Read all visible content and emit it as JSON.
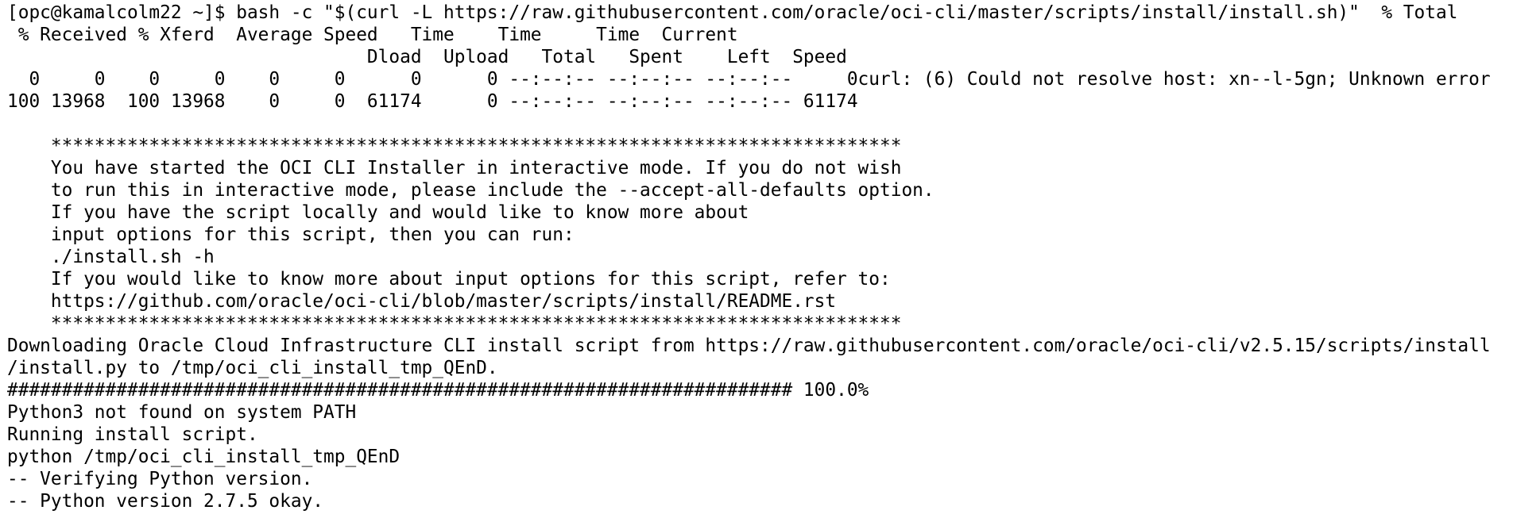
{
  "terminal": {
    "background": "#ffffff",
    "foreground": "#000000",
    "lines": [
      "[opc@kamalcolm22 ~]$ bash -c \"$(curl -L https://raw.githubusercontent.com/oracle/oci-cli/master/scripts/install/install.sh)\"  % Total",
      " % Received % Xferd  Average Speed   Time    Time     Time  Current",
      "                                 Dload  Upload   Total   Spent    Left  Speed",
      "  0     0    0     0    0     0      0      0 --:--:-- --:--:-- --:--:--     0curl: (6) Could not resolve host: xn--l-5gn; Unknown error",
      "100 13968  100 13968    0     0  61174      0 --:--:-- --:--:-- --:--:-- 61174",
      "",
      "    ******************************************************************************",
      "    You have started the OCI CLI Installer in interactive mode. If you do not wish",
      "    to run this in interactive mode, please include the --accept-all-defaults option.",
      "    If you have the script locally and would like to know more about",
      "    input options for this script, then you can run:",
      "    ./install.sh -h",
      "    If you would like to know more about input options for this script, refer to:",
      "    https://github.com/oracle/oci-cli/blob/master/scripts/install/README.rst",
      "    ******************************************************************************",
      "Downloading Oracle Cloud Infrastructure CLI install script from https://raw.githubusercontent.com/oracle/oci-cli/v2.5.15/scripts/install",
      "/install.py to /tmp/oci_cli_install_tmp_QEnD.",
      "######################################################################## 100.0%",
      "Python3 not found on system PATH",
      "Running install script.",
      "python /tmp/oci_cli_install_tmp_QEnD",
      "-- Verifying Python version.",
      "-- Python version 2.7.5 okay."
    ]
  }
}
